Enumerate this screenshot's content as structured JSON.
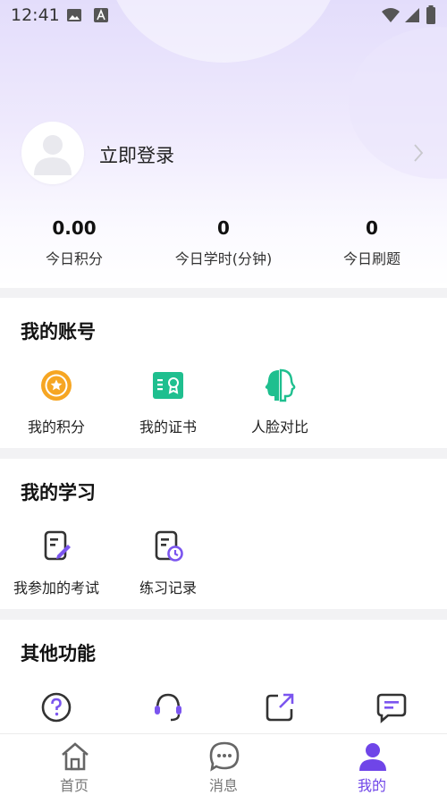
{
  "status_bar": {
    "time": "12:41"
  },
  "profile": {
    "login_label": "立即登录"
  },
  "stats": [
    {
      "value": "0.00",
      "label": "今日积分"
    },
    {
      "value": "0",
      "label": "今日学时(分钟)"
    },
    {
      "value": "0",
      "label": "今日刷题"
    }
  ],
  "account": {
    "title": "我的账号",
    "items": [
      {
        "label": "我的积分",
        "icon": "coin-star-icon"
      },
      {
        "label": "我的证书",
        "icon": "certificate-icon"
      },
      {
        "label": "人脸对比",
        "icon": "face-compare-icon"
      }
    ]
  },
  "study": {
    "title": "我的学习",
    "items": [
      {
        "label": "我参加的考试",
        "icon": "exam-edit-icon"
      },
      {
        "label": "练习记录",
        "icon": "practice-history-icon"
      }
    ]
  },
  "other": {
    "title": "其他功能",
    "icons": [
      "help-icon",
      "customer-service-icon",
      "share-icon",
      "feedback-icon"
    ]
  },
  "tabbar": {
    "items": [
      {
        "label": "首页",
        "icon": "home-icon",
        "active": false
      },
      {
        "label": "消息",
        "icon": "message-icon",
        "active": false
      },
      {
        "label": "我的",
        "icon": "profile-icon",
        "active": true
      }
    ]
  },
  "colors": {
    "accent": "#6f45e8",
    "coin": "#f6a623",
    "green": "#1fbf8f",
    "icon_dark": "#333333"
  }
}
